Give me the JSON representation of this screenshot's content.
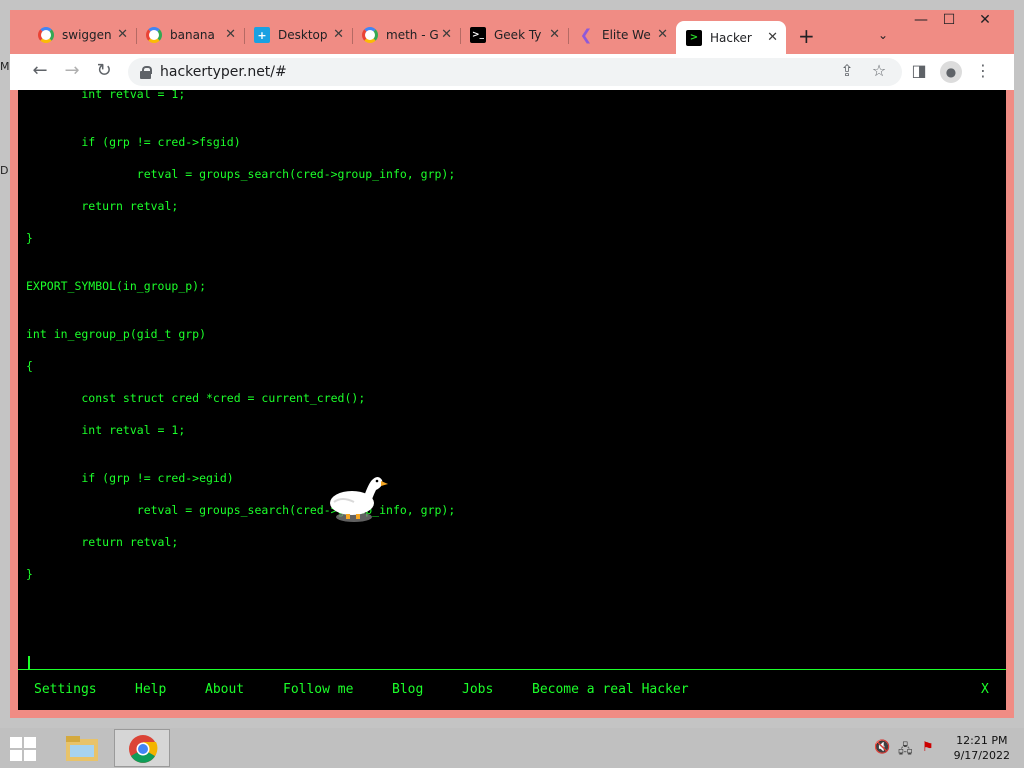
{
  "desktop": {
    "glyphs": [
      "M",
      "D"
    ]
  },
  "browser": {
    "tabs": [
      {
        "label": "swiggen",
        "icon": "google-icon"
      },
      {
        "label": "banana",
        "icon": "google-icon"
      },
      {
        "label": "Desktop",
        "icon": "desktop-icon"
      },
      {
        "label": "meth - G",
        "icon": "google-icon"
      },
      {
        "label": "Geek Ty",
        "icon": "terminal-icon"
      },
      {
        "label": "Elite We",
        "icon": "elite-icon"
      },
      {
        "label": "Hacker",
        "icon": "hacker-icon",
        "active": true
      }
    ],
    "close_glyph": "✕",
    "new_tab_glyph": "+",
    "tab_search_glyph": "⌄",
    "window_controls": {
      "minimize": "—",
      "maximize": "☐",
      "close": "✕"
    },
    "nav": {
      "back": "←",
      "forward": "→",
      "reload": "↻"
    },
    "url": "hackertyper.net/#",
    "toolbar_icons": {
      "share": "⇪",
      "bookmark": "☆",
      "sidepanel": "◨",
      "profile": "●",
      "menu": "⋮"
    }
  },
  "page": {
    "code_lines": [
      "        int retval = 1;",
      "",
      "",
      "        if (grp != cred->fsgid)",
      "",
      "                retval = groups_search(cred->group_info, grp);",
      "",
      "        return retval;",
      "",
      "}",
      "",
      "",
      "EXPORT_SYMBOL(in_group_p);",
      "",
      "",
      "int in_egroup_p(gid_t grp)",
      "",
      "{",
      "",
      "        const struct cred *cred = current_cred();",
      "",
      "        int retval = 1;",
      "",
      "",
      "        if (grp != cred->egid)",
      "",
      "                retval = groups_search(cred->group_info, grp);",
      "",
      "        return retval;",
      "",
      "}"
    ],
    "menu": [
      "Settings",
      "Help",
      "About",
      "Follow me",
      "Blog",
      "Jobs",
      "Become a real Hacker"
    ],
    "close_label": "X"
  },
  "taskbar": {
    "time": "12:21 PM",
    "date": "9/17/2022"
  },
  "colors": {
    "code": "#1cff2a",
    "page_bg": "#000000",
    "window_frame": "#f08c84"
  }
}
